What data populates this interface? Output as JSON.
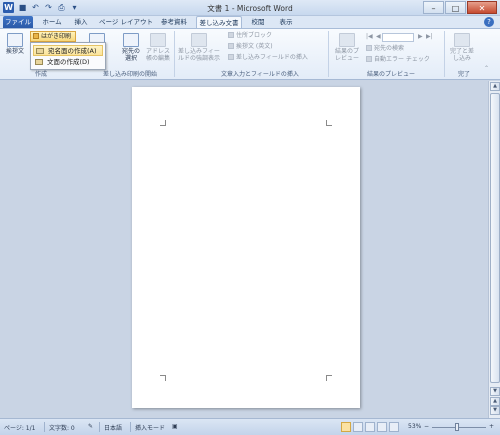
{
  "window": {
    "title": "文書 1 - Microsoft Word",
    "minimize": "–",
    "maximize": "□",
    "close": "✕"
  },
  "tabs": [
    "ファイル",
    "ホーム",
    "挿入",
    "ページ レイアウト",
    "参考資料",
    "差し込み文書",
    "校閲",
    "表示"
  ],
  "active_tab": "差し込み文書",
  "ribbon": {
    "greeting_label": "挨拶文",
    "postcard_label": "はがき印刷",
    "start_merge_label": "差し込み印刷の開始",
    "select_recipients_label": "宛先の選択",
    "edit_list_label": "アドレス帳の編集",
    "highlight_fields_label": "差し込みフィールドの強調表示",
    "address_block_label": "住所ブロック",
    "greeting_line_label": "挨拶文 (英文)",
    "insert_merge_field_label": "差し込みフィールドの挿入",
    "preview_label": "結果のプレビュー",
    "find_recipient_label": "宛先の検索",
    "auto_check_label": "自動エラー チェック",
    "finish_label": "完了と差し込み",
    "group_create": "作成",
    "group_start": "差し込み印刷の開始",
    "group_write": "文章入力とフィールドの挿入",
    "group_preview": "結果のプレビュー",
    "group_finish": "完了"
  },
  "menu": {
    "items": [
      "宛名面の作成(A)",
      "文面の作成(D)"
    ]
  },
  "status": {
    "page": "ページ: 1/1",
    "words": "文字数: 0",
    "language": "日本語",
    "mode": "挿入モード",
    "zoom": "53%"
  }
}
